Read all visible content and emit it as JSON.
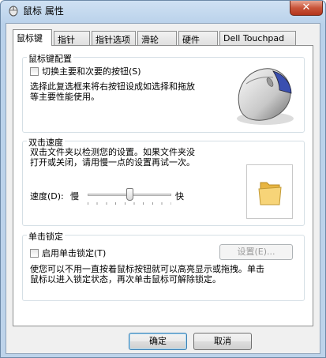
{
  "window": {
    "title": "鼠标 属性",
    "close_label": "✕"
  },
  "tabs": [
    {
      "label": "鼠标键",
      "active": true
    },
    {
      "label": "指针"
    },
    {
      "label": "指针选项"
    },
    {
      "label": "滑轮"
    },
    {
      "label": "硬件"
    },
    {
      "label": "Dell Touchpad"
    }
  ],
  "buttons_config": {
    "title": "鼠标键配置",
    "swap_label": "切换主要和次要的按钮(S)",
    "desc_line1": "选择此复选框来将右按钮设成如选择和拖放",
    "desc_line2": "等主要性能使用。"
  },
  "double_click": {
    "title": "双击速度",
    "desc_line1": "双击文件夹以检测您的设置。如果文件夹没",
    "desc_line2": "打开或关闭，请用慢一点的设置再试一次。",
    "speed_label": "速度(D):",
    "slow_label": "慢",
    "fast_label": "快",
    "speed_value": 0.5
  },
  "click_lock": {
    "title": "单击锁定",
    "enable_label": "启用单击锁定(T)",
    "settings_label": "设置(E)...",
    "desc_line1": "使您可以不用一直按着鼠标按钮就可以高亮显示或拖拽。单击",
    "desc_line2": "鼠标以进入锁定状态，再次单击鼠标可解除锁定。"
  },
  "footer": {
    "ok_label": "确定",
    "cancel_label": "取消"
  },
  "colors": {
    "accent": "#3c7fb1",
    "close": "#c9553a",
    "folder": "#f2c45a"
  }
}
